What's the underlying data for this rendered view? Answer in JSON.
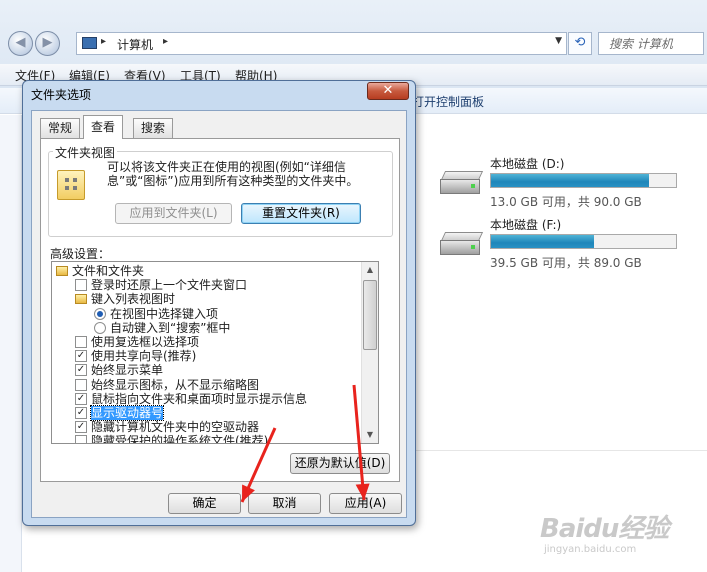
{
  "explorer": {
    "breadcrumb": "计算机",
    "search_placeholder": "搜索 计算机",
    "menus": [
      "文件(F)",
      "编辑(E)",
      "查看(V)",
      "工具(T)",
      "帮助(H)"
    ],
    "toolbar_visible": "打开控制面板",
    "drives": [
      {
        "name": "本地磁盘 (D:)",
        "info": "13.0 GB 可用，共 90.0 GB",
        "used_fraction": 0.856
      },
      {
        "name": "本地磁盘 (F:)",
        "info": "39.5 GB 可用，共 89.0 GB",
        "used_fraction": 0.556
      }
    ]
  },
  "dialog": {
    "title": "文件夹选项",
    "close_label": "✕",
    "tabs": [
      "常规",
      "查看",
      "搜索"
    ],
    "active_tab": "查看",
    "group": {
      "title": "文件夹视图",
      "description": "可以将该文件夹正在使用的视图(例如“详细信息”或“图标”)应用到所有这种类型的文件夹中。",
      "apply_button": "应用到文件夹(L)",
      "reset_button": "重置文件夹(R)"
    },
    "advanced_label": "高级设置：",
    "tree": [
      {
        "type": "folder",
        "indent": 0,
        "label": "文件和文件夹"
      },
      {
        "type": "checkbox",
        "indent": 1,
        "checked": false,
        "label": "登录时还原上一个文件夹窗口"
      },
      {
        "type": "folder",
        "indent": 1,
        "label": "键入列表视图时"
      },
      {
        "type": "radio",
        "indent": 2,
        "checked": true,
        "label": "在视图中选择键入项"
      },
      {
        "type": "radio",
        "indent": 2,
        "checked": false,
        "label": "自动键入到“搜索”框中"
      },
      {
        "type": "checkbox",
        "indent": 1,
        "checked": false,
        "label": "使用复选框以选择项"
      },
      {
        "type": "checkbox",
        "indent": 1,
        "checked": true,
        "label": "使用共享向导(推荐)"
      },
      {
        "type": "checkbox",
        "indent": 1,
        "checked": true,
        "label": "始终显示菜单"
      },
      {
        "type": "checkbox",
        "indent": 1,
        "checked": false,
        "label": "始终显示图标，从不显示缩略图"
      },
      {
        "type": "checkbox",
        "indent": 1,
        "checked": true,
        "label": "鼠标指向文件夹和桌面项时显示提示信息"
      },
      {
        "type": "checkbox",
        "indent": 1,
        "checked": true,
        "label": "显示驱动器号",
        "selected": true
      },
      {
        "type": "checkbox",
        "indent": 1,
        "checked": true,
        "label": "隐藏计算机文件夹中的空驱动器"
      },
      {
        "type": "checkbox",
        "indent": 1,
        "checked": false,
        "label": "隐藏受保护的操作系统文件(推荐)"
      }
    ],
    "restore_defaults": "还原为默认值(D)",
    "ok": "确定",
    "cancel": "取消",
    "apply": "应用(A)"
  },
  "watermark": {
    "main": "Baidu经验",
    "sub": "jingyan.baidu.com"
  },
  "colors": {
    "annotation_arrow": "#e8231d",
    "selection": "#3399ff",
    "progress": "#1f86ba"
  }
}
